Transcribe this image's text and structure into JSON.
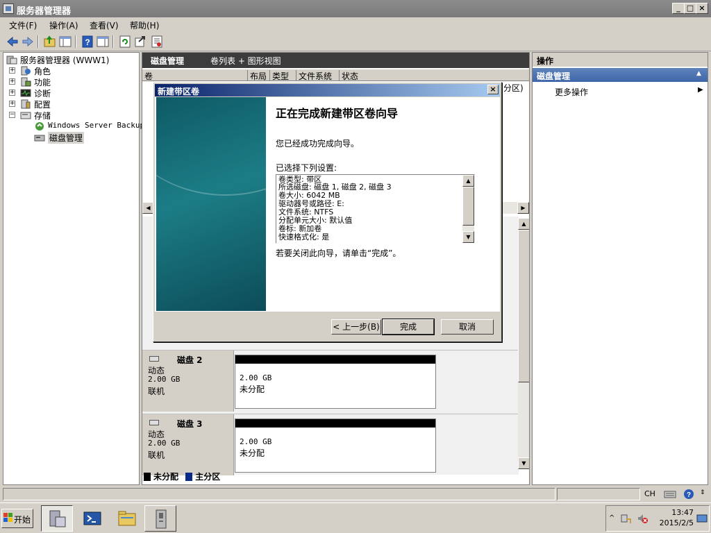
{
  "window": {
    "title": "服务器管理器"
  },
  "menu": [
    "文件(F)",
    "操作(A)",
    "查看(V)",
    "帮助(H)"
  ],
  "tree": {
    "root": "服务器管理器 (WWW1)",
    "items": [
      {
        "label": "角色",
        "icon": "roles-icon"
      },
      {
        "label": "功能",
        "icon": "features-icon"
      },
      {
        "label": "诊断",
        "icon": "diagnostics-icon"
      },
      {
        "label": "配置",
        "icon": "configuration-icon"
      },
      {
        "label": "存储",
        "icon": "storage-icon"
      }
    ],
    "storage_children": [
      {
        "label": "Windows Server Backup",
        "icon": "backup-icon"
      },
      {
        "label": "磁盘管理",
        "icon": "disk-management-icon"
      }
    ]
  },
  "center": {
    "title": "磁盘管理",
    "view": "卷列表 + 图形视图",
    "columns": [
      "卷",
      "布局",
      "类型",
      "文件系统",
      "状态"
    ],
    "partial_text": "分区)",
    "disks": [
      {
        "name": "磁盘 2",
        "type": "动态",
        "size": "2.00 GB",
        "status": "联机",
        "part_size": "2.00 GB",
        "part_state": "未分配"
      },
      {
        "name": "磁盘 3",
        "type": "动态",
        "size": "2.00 GB",
        "status": "联机",
        "part_size": "2.00 GB",
        "part_state": "未分配"
      }
    ],
    "legend": {
      "unallocated": "未分配",
      "primary": "主分区"
    }
  },
  "actions": {
    "header": "操作",
    "section": "磁盘管理",
    "more": "更多操作"
  },
  "dialog": {
    "title": "新建带区卷",
    "heading": "正在完成新建带区卷向导",
    "completed": "您已经成功完成向导。",
    "settings_label": "已选择下列设置:",
    "settings": [
      "卷类型: 带区",
      "所选磁盘: 磁盘 1, 磁盘 2, 磁盘 3",
      "卷大小: 6042 MB",
      "驱动器号或路径: E:",
      "文件系统: NTFS",
      "分配单元大小: 默认值",
      "卷标: 新加卷",
      "快速格式化: 是"
    ],
    "close_hint": "若要关闭此向导，请单击“完成”。",
    "back_button": "< 上一步(B)",
    "finish_button": "完成",
    "cancel_button": "取消"
  },
  "status": {
    "ime": "CH"
  },
  "taskbar": {
    "start": "开始",
    "time": "13:47",
    "date": "2015/2/5"
  },
  "colors": {
    "unallocated": "#000000",
    "primary": "#0a2a8a",
    "dialog_title": "#0a246a"
  }
}
